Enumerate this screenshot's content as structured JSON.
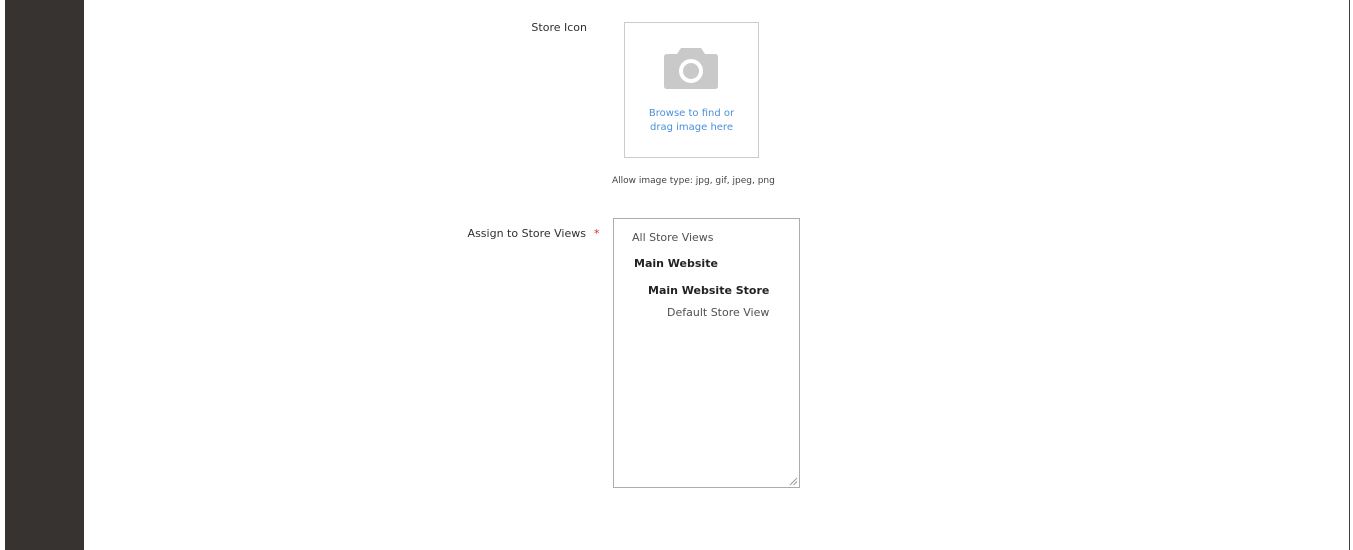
{
  "form": {
    "store_icon": {
      "label": "Store Icon",
      "uploader_line1": "Browse to find or",
      "uploader_line2": "drag image here",
      "allowed_types_note": "Allow image type: jpg, gif, jpeg, png",
      "icon": "camera-icon"
    },
    "assign_store_views": {
      "label": "Assign to Store Views",
      "required_marker": "*",
      "options": [
        {
          "label": "All Store Views"
        },
        {
          "label": "Main Website"
        },
        {
          "label": "Main Website Store"
        },
        {
          "label": "Default Store View"
        }
      ]
    }
  },
  "colors": {
    "sidebar": "#373330",
    "link": "#4a90d9",
    "required": "#e22626"
  }
}
